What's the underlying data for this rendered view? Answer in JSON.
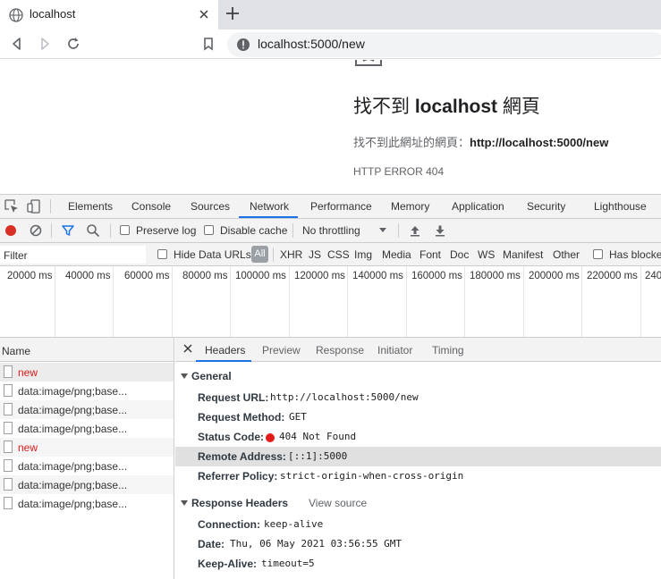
{
  "browser": {
    "tab_title": "localhost",
    "url": "localhost:5000/new"
  },
  "page": {
    "error_title_prefix": "找不到 ",
    "error_title_host": "localhost",
    "error_title_suffix": " 網頁",
    "error_desc_prefix": "找不到此網址的網頁：",
    "error_desc_url": "http://localhost:5000/new",
    "error_code": "HTTP ERROR 404"
  },
  "devtools": {
    "tabs": [
      "Elements",
      "Console",
      "Sources",
      "Network",
      "Performance",
      "Memory",
      "Application",
      "Security",
      "Lighthouse"
    ],
    "active_tab": "Network",
    "network_toolbar": {
      "preserve_log": "Preserve log",
      "disable_cache": "Disable cache",
      "throttling": "No throttling"
    },
    "filter": {
      "placeholder": "Filter",
      "hide_data_urls": "Hide Data URLs",
      "types": [
        "All",
        "XHR",
        "JS",
        "CSS",
        "Img",
        "Media",
        "Font",
        "Doc",
        "WS",
        "Manifest",
        "Other"
      ],
      "has_blocked": "Has blocke"
    },
    "timeline_ticks": [
      "20000 ms",
      "40000 ms",
      "60000 ms",
      "80000 ms",
      "100000 ms",
      "120000 ms",
      "140000 ms",
      "160000 ms",
      "180000 ms",
      "200000 ms",
      "220000 ms",
      "240"
    ],
    "request_list": {
      "header": "Name",
      "rows": [
        {
          "name": "new",
          "error": true
        },
        {
          "name": "data:image/png;base...",
          "error": false
        },
        {
          "name": "data:image/png;base...",
          "error": false
        },
        {
          "name": "data:image/png;base...",
          "error": false
        },
        {
          "name": "new",
          "error": true
        },
        {
          "name": "data:image/png;base...",
          "error": false
        },
        {
          "name": "data:image/png;base...",
          "error": false
        },
        {
          "name": "data:image/png;base...",
          "error": false
        }
      ]
    },
    "detail": {
      "tabs": [
        "Headers",
        "Preview",
        "Response",
        "Initiator",
        "Timing"
      ],
      "active_tab": "Headers",
      "general_title": "General",
      "general": [
        {
          "key": "Request URL:",
          "value": "http://localhost:5000/new"
        },
        {
          "key": "Request Method:",
          "value": "GET"
        },
        {
          "key": "Status Code:",
          "value": "404 Not Found"
        },
        {
          "key": "Remote Address:",
          "value": "[::1]:5000"
        },
        {
          "key": "Referrer Policy:",
          "value": "strict-origin-when-cross-origin"
        }
      ],
      "response_headers_title": "Response Headers",
      "view_source": "View source",
      "response_headers": [
        {
          "key": "Connection:",
          "value": "keep-alive"
        },
        {
          "key": "Date:",
          "value": "Thu, 06 May 2021 03:56:55 GMT"
        },
        {
          "key": "Keep-Alive:",
          "value": "timeout=5"
        }
      ]
    }
  },
  "colors": {
    "error_red": "#e21a1a",
    "accent_blue": "#1a73e8",
    "record_red": "#d93025"
  }
}
